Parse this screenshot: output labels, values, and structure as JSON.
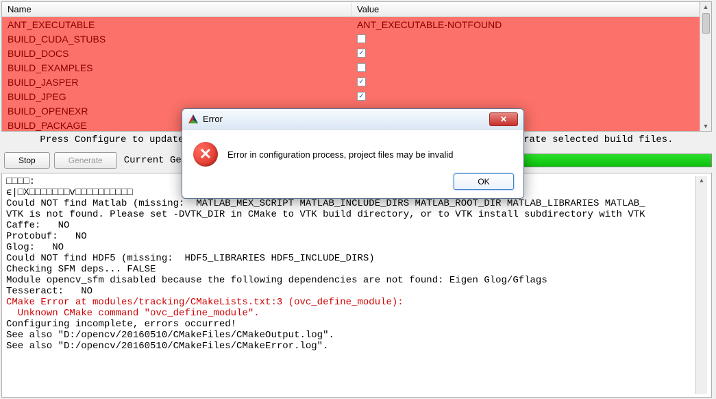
{
  "table": {
    "headers": {
      "name": "Name",
      "value": "Value"
    },
    "rows": [
      {
        "name": "ANT_EXECUTABLE",
        "type": "text",
        "value": "ANT_EXECUTABLE-NOTFOUND"
      },
      {
        "name": "BUILD_CUDA_STUBS",
        "type": "bool",
        "checked": false
      },
      {
        "name": "BUILD_DOCS",
        "type": "bool",
        "checked": true
      },
      {
        "name": "BUILD_EXAMPLES",
        "type": "bool",
        "checked": false
      },
      {
        "name": "BUILD_JASPER",
        "type": "bool",
        "checked": true
      },
      {
        "name": "BUILD_JPEG",
        "type": "bool",
        "checked": true
      },
      {
        "name": "BUILD_OPENEXR",
        "type": "bool",
        "checked": null
      },
      {
        "name": "BUILD_PACKAGE",
        "type": "bool",
        "checked": null
      }
    ]
  },
  "status_line": "Press Configure to update and display new values in red, then press Generate to generate selected build files.",
  "buttons": {
    "stop": "Stop",
    "generate": "Generate",
    "current_label": "Current Generator:"
  },
  "output": {
    "lines": [
      {
        "t": "□□□□:",
        "cls": ""
      },
      {
        "t": "ϵ|□X□□□□□□□v□□□□□□□□□□",
        "cls": ""
      },
      {
        "t": "",
        "cls": ""
      },
      {
        "t": "Could NOT find Matlab (missing:  MATLAB_MEX_SCRIPT MATLAB_INCLUDE_DIRS MATLAB_ROOT_DIR MATLAB_LIBRARIES MATLAB_",
        "cls": ""
      },
      {
        "t": "VTK is not found. Please set -DVTK_DIR in CMake to VTK build directory, or to VTK install subdirectory with VTK",
        "cls": ""
      },
      {
        "t": "Caffe:   NO",
        "cls": ""
      },
      {
        "t": "Protobuf:   NO",
        "cls": ""
      },
      {
        "t": "Glog:   NO",
        "cls": ""
      },
      {
        "t": "Could NOT find HDF5 (missing:  HDF5_LIBRARIES HDF5_INCLUDE_DIRS)",
        "cls": ""
      },
      {
        "t": "Checking SFM deps... FALSE",
        "cls": ""
      },
      {
        "t": "Module opencv_sfm disabled because the following dependencies are not found: Eigen Glog/Gflags",
        "cls": ""
      },
      {
        "t": "Tesseract:   NO",
        "cls": ""
      },
      {
        "t": "CMake Error at modules/tracking/CMakeLists.txt:3 (ovc_define_module):",
        "cls": "red"
      },
      {
        "t": "  Unknown CMake command \"ovc_define_module\".",
        "cls": "red"
      },
      {
        "t": "",
        "cls": ""
      },
      {
        "t": "",
        "cls": ""
      },
      {
        "t": "Configuring incomplete, errors occurred!",
        "cls": ""
      },
      {
        "t": "See also \"D:/opencv/20160510/CMakeFiles/CMakeOutput.log\".",
        "cls": ""
      },
      {
        "t": "See also \"D:/opencv/20160510/CMakeFiles/CMakeError.log\".",
        "cls": ""
      }
    ]
  },
  "dialog": {
    "title": "Error",
    "message": "Error in configuration process, project files may be invalid",
    "ok": "OK",
    "close_glyph": "✕"
  }
}
